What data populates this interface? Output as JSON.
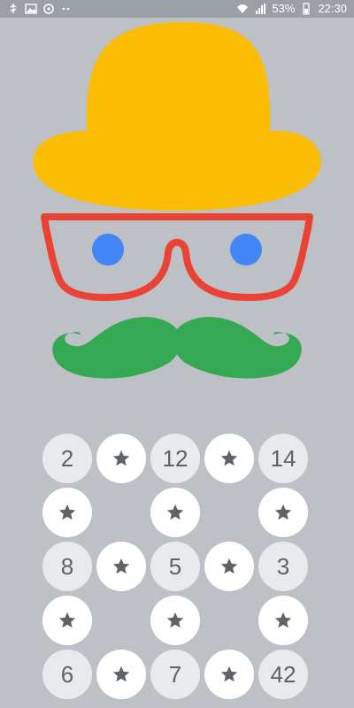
{
  "status_bar": {
    "left_icons": [
      "usb-icon",
      "image-icon",
      "sync-icon",
      "more-icon"
    ],
    "right_icons": [
      "wifi-icon",
      "signal-icon",
      "battery-icon"
    ],
    "battery": "53%",
    "time": "22:30"
  },
  "face": {
    "hat_color": "#fbbc04",
    "glasses_color": "#ea4335",
    "eye_color": "#4285f4",
    "mustache_color": "#34a853"
  },
  "grid": {
    "rows": [
      [
        {
          "type": "number",
          "value": "2"
        },
        {
          "type": "star"
        },
        {
          "type": "number",
          "value": "12"
        },
        {
          "type": "star"
        },
        {
          "type": "number",
          "value": "14"
        }
      ],
      [
        {
          "type": "star"
        },
        {
          "type": "empty"
        },
        {
          "type": "star"
        },
        {
          "type": "empty"
        },
        {
          "type": "star"
        }
      ],
      [
        {
          "type": "number",
          "value": "8"
        },
        {
          "type": "star"
        },
        {
          "type": "number",
          "value": "5"
        },
        {
          "type": "star"
        },
        {
          "type": "number",
          "value": "3"
        }
      ],
      [
        {
          "type": "star"
        },
        {
          "type": "empty"
        },
        {
          "type": "star"
        },
        {
          "type": "empty"
        },
        {
          "type": "star"
        }
      ],
      [
        {
          "type": "number",
          "value": "6"
        },
        {
          "type": "star"
        },
        {
          "type": "number",
          "value": "7"
        },
        {
          "type": "star"
        },
        {
          "type": "number",
          "value": "42"
        }
      ]
    ]
  }
}
